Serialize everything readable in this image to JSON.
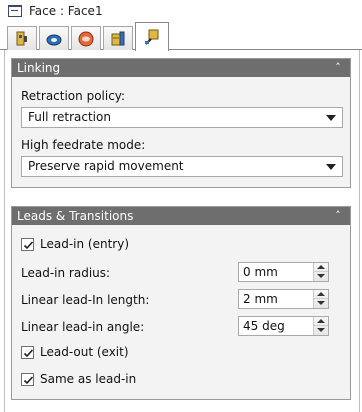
{
  "window": {
    "title": "Face : Face1"
  },
  "tabs": [
    {
      "name": "tool",
      "icon": "tool-holder-icon"
    },
    {
      "name": "geometry",
      "icon": "geometry-icon"
    },
    {
      "name": "heights",
      "icon": "heights-icon"
    },
    {
      "name": "passes",
      "icon": "passes-icon"
    },
    {
      "name": "linking",
      "icon": "linking-icon",
      "active": true
    }
  ],
  "linking": {
    "header": "Linking",
    "retraction_label": "Retraction policy:",
    "retraction_value": "Full retraction",
    "feedrate_label": "High feedrate mode:",
    "feedrate_value": "Preserve rapid movement"
  },
  "leads": {
    "header": "Leads & Transitions",
    "lead_in_label": "Lead-in (entry)",
    "lead_in_checked": true,
    "radius_label": "Lead-in radius:",
    "radius_value": "0 mm",
    "linear_length_label": "Linear lead-In length:",
    "linear_length_value": "2 mm",
    "linear_angle_label": "Linear lead-in angle:",
    "linear_angle_value": "45 deg",
    "lead_out_label": "Lead-out (exit)",
    "lead_out_checked": true,
    "same_as_label": "Same as lead-in",
    "same_as_checked": true
  },
  "colors": {
    "group_header": "#6e6e6e",
    "group_body": "#f3f3f3"
  }
}
